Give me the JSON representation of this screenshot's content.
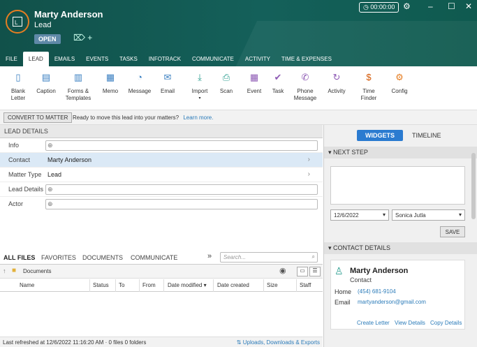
{
  "header": {
    "name": "Marty Anderson",
    "subtitle": "Lead",
    "status_badge": "OPEN",
    "timer": "00:00:00"
  },
  "tabs": [
    "FILE",
    "LEAD",
    "EMAILS",
    "EVENTS",
    "TASKS",
    "INFOTRACK",
    "COMMUNICATE",
    "ACTIVITY",
    "TIME & EXPENSES"
  ],
  "ribbon": {
    "blank_letter": [
      "Blank",
      "Letter"
    ],
    "caption": "Caption",
    "forms": [
      "Forms &",
      "Templates"
    ],
    "memo": "Memo",
    "message": "Message",
    "email": "Email",
    "import": "Import",
    "scan": "Scan",
    "event": "Event",
    "task": "Task",
    "phone_message": [
      "Phone",
      "Message"
    ],
    "activity": "Activity",
    "time_finder": [
      "Time",
      "Finder"
    ],
    "config": "Config"
  },
  "convert": {
    "button": "CONVERT TO MATTER",
    "text": "Ready to move this lead into your matters?",
    "link": "Learn more."
  },
  "lead_details": {
    "title": "LEAD DETAILS",
    "info_label": "Info",
    "contact_label": "Contact",
    "contact_value": "Marty Anderson",
    "matter_type_label": "Matter Type",
    "matter_type_value": "Lead",
    "lead_details_label": "Lead Details",
    "actor_label": "Actor"
  },
  "files": {
    "tabs": [
      "ALL FILES",
      "FAVORITES",
      "DOCUMENTS",
      "COMMUNICATE"
    ],
    "search_placeholder": "Search...",
    "folder": "Documents",
    "columns": [
      "Name",
      "Status",
      "To",
      "From",
      "Date modified",
      "Date created",
      "Size",
      "Staff"
    ]
  },
  "statusbar": {
    "text": "Last refreshed at 12/6/2022 11:16:20 AM  ·  0 files  0 folders",
    "link": "Uploads, Downloads & Exports"
  },
  "widgets": {
    "widgets_tab": "WIDGETS",
    "timeline_tab": "TIMELINE",
    "next_step": "NEXT STEP",
    "date": "12/6/2022",
    "user": "Sonica Jutla",
    "save": "SAVE",
    "contact_details": "CONTACT DETAILS",
    "contact_name": "Marty Anderson",
    "contact_role": "Contact",
    "home_label": "Home",
    "home_phone": "(454) 681-9104",
    "email_label": "Email",
    "email": "martyanderson@gmail.com",
    "create_letter": "Create Letter",
    "view_details": "View Details",
    "copy_details": "Copy Details"
  }
}
